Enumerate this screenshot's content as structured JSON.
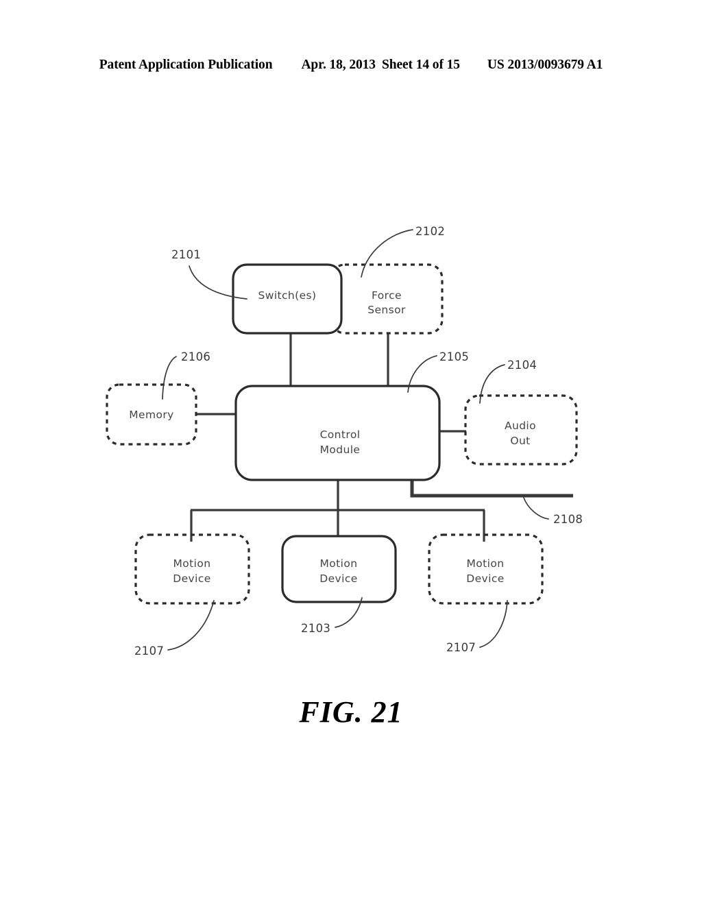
{
  "header": {
    "publication": "Patent Application Publication",
    "date": "Apr. 18, 2013",
    "sheet": "Sheet 14 of 15",
    "patent_number": "US 2013/0093679 A1"
  },
  "figure": {
    "caption": "FIG. 21"
  },
  "diagram": {
    "boxes": {
      "switches": {
        "label": "Switch(es)",
        "ref": "2101",
        "style": "solid"
      },
      "force_sensor": {
        "label_line1": "Force",
        "label_line2": "Sensor",
        "ref": "2102",
        "style": "dashed"
      },
      "memory": {
        "label": "Memory",
        "ref": "2106",
        "style": "dashed"
      },
      "control_module": {
        "label_line1": "Control",
        "label_line2": "Module",
        "ref": "2105",
        "style": "solid"
      },
      "audio_out": {
        "label_line1": "Audio",
        "label_line2": "Out",
        "ref": "2104",
        "style": "dashed"
      },
      "motion_device_left": {
        "label_line1": "Motion",
        "label_line2": "Device",
        "ref": "2107",
        "style": "dashed"
      },
      "motion_device_center": {
        "label_line1": "Motion",
        "label_line2": "Device",
        "ref": "2103",
        "style": "solid"
      },
      "motion_device_right": {
        "label_line1": "Motion",
        "label_line2": "Device",
        "ref": "2107",
        "style": "dashed"
      }
    },
    "bus": {
      "ref": "2108"
    }
  }
}
